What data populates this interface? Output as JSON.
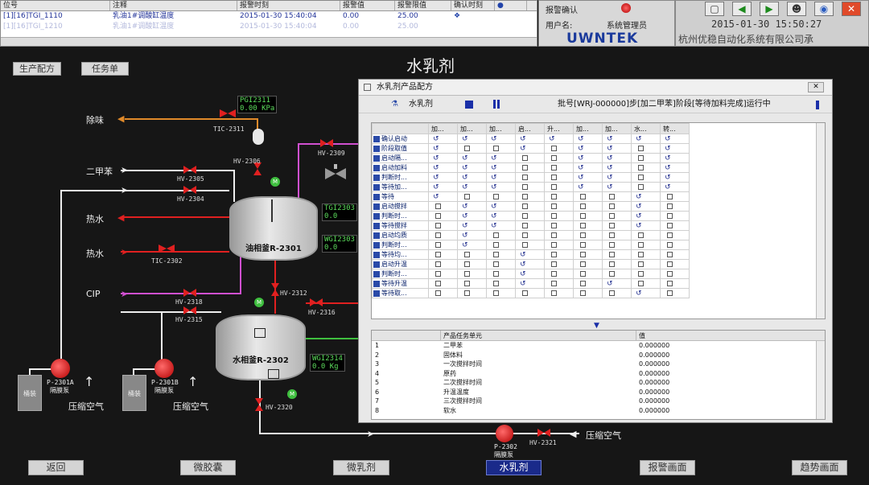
{
  "alarm": {
    "columns": [
      "位号",
      "注释",
      "报警时刻",
      "报警值",
      "报警限值",
      "确认时刻"
    ],
    "rows": [
      {
        "tag": "[1][16]TGI_1110",
        "comment": "乳油1#调酸缸温度",
        "time": "2015-01-30 15:40:04",
        "value": "0.00",
        "limit": "25.00"
      },
      {
        "tag": "[1][16]TGI_1210",
        "comment": "乳油1#调酸缸温度",
        "time": "2015-01-30 15:40:04",
        "value": "0.00",
        "limit": "25.00"
      }
    ]
  },
  "user": {
    "confirm": "报警确认",
    "user_label": "用户名:",
    "user_name": "系统管理员",
    "logo": "UWNTEK"
  },
  "top": {
    "datetime": "2015-01-30  15:50:27",
    "company": "杭州优稳自动化系统有限公司承"
  },
  "main": {
    "title": "水乳剂",
    "btn_recipe": "生产配方",
    "btn_task": "任务单"
  },
  "process": {
    "lines": [
      "除味",
      "二甲苯",
      "热水",
      "热水",
      "CIP"
    ],
    "air1": "压缩空气",
    "air2": "压缩空气",
    "air3": "压缩空气",
    "tank1": "油相釜R-2301",
    "tank2": "水相釜R-2302",
    "pump1": "P-2301A",
    "pump2": "P-2301B",
    "pump3": "P-2302",
    "pump_sub": "隔膜泵",
    "box1": "桶装",
    "box2": "桶装",
    "tags": {
      "tic2311": "TIC-2311",
      "tic2302": "TIC-2302",
      "hv2309": "HV-2309",
      "hv2305": "HV-2305",
      "hv2304": "HV-2304",
      "hv2306": "HV-2306",
      "hv2312": "HV-2312",
      "hv2316": "HV-2316",
      "hv2318": "HV-2318",
      "hv2315": "HV-2315",
      "hv2320": "HV-2320",
      "hv2321": "HV-2321"
    },
    "readouts": {
      "pgi2311": "PGI2311",
      "pgi2311_val": "0.00  KPa",
      "tgi2303": "TGI2303",
      "tgi2303_val": "0.0",
      "wgi2303": "WGI2303",
      "wgi2303_val": "0.0",
      "wgi2314": "WGI2314",
      "wgi2314_val": "0.0  Kg"
    }
  },
  "dialog": {
    "title": "水乳剂产品配方",
    "tool_name": "水乳剂",
    "batch": "批号[WRJ-000000]步[加二甲苯]阶段[等待加料完成]运行中",
    "close": "✕",
    "col_headers": [
      "加...",
      "加...",
      "加...",
      "启...",
      "升...",
      "加...",
      "加...",
      "水...",
      "转..."
    ],
    "row_labels": [
      "确认启动",
      "阶段取值",
      "启动隔...",
      "启动加料",
      "判断时...",
      "等待加...",
      "等待",
      "启动搅拌",
      "判断时...",
      "等待搅拌",
      "启动均质",
      "判断时...",
      "等待均...",
      "启动升温",
      "判断时...",
      "等待升温",
      "等待取..."
    ]
  },
  "tasks": {
    "col_unit": "产品任务单元",
    "col_value": "值",
    "items": [
      {
        "no": "1",
        "name": "二甲苯",
        "value": "0.000000"
      },
      {
        "no": "2",
        "name": "固体料",
        "value": "0.000000"
      },
      {
        "no": "3",
        "name": "一次搅拌时间",
        "value": "0.000000"
      },
      {
        "no": "4",
        "name": "原药",
        "value": "0.000000"
      },
      {
        "no": "5",
        "name": "二次搅拌时间",
        "value": "0.000000"
      },
      {
        "no": "6",
        "name": "升温温度",
        "value": "0.000000"
      },
      {
        "no": "7",
        "name": "三次搅拌时间",
        "value": "0.000000"
      },
      {
        "no": "8",
        "name": "软水",
        "value": "0.000000"
      }
    ]
  },
  "nav": {
    "back": "返回",
    "tab1": "微胶囊",
    "tab2": "微乳剂",
    "tab3": "水乳剂",
    "alarm": "报警画面",
    "trend": "趋势画面"
  },
  "colors": {
    "water": "#e02020",
    "steam": "#d050d0",
    "odor": "#e08a2a",
    "nav_active": "#1a2a8a"
  }
}
